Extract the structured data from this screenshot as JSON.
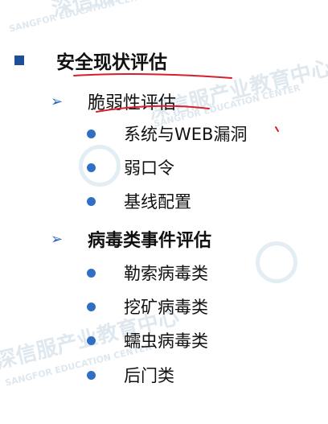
{
  "watermark": {
    "brand_cn": "深信服产业教育中心",
    "brand_en": "SANGFOR EDUCATION CENTER"
  },
  "outline": {
    "heading": "安全现状评估",
    "section1": {
      "title": "脆弱性评估",
      "items": [
        "系统与WEB漏洞",
        "弱口令",
        "基线配置"
      ]
    },
    "section2": {
      "title": "病毒类事件评估",
      "items": [
        "勒索病毒类",
        "挖矿病毒类",
        "蠕虫病毒类",
        "后门类"
      ]
    }
  },
  "colors": {
    "square_bullet": "#1f4e98",
    "arrow_bullet": "#2f67b5",
    "dot_bullet": "#2f6fc4",
    "annotation_ink": "#d81e2c"
  }
}
